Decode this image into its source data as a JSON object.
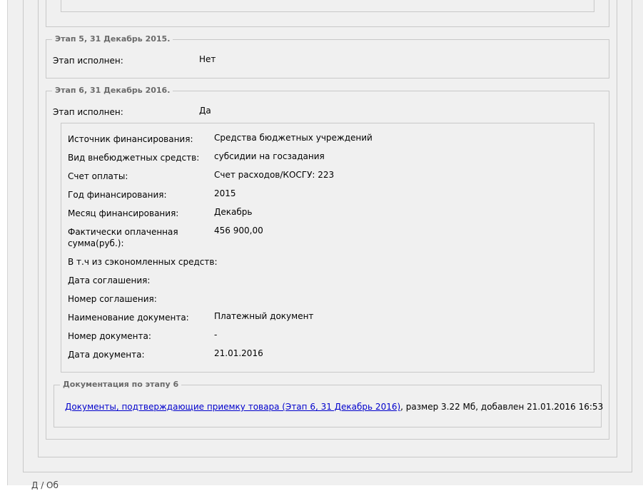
{
  "stage5": {
    "legend": "Этап 5, 31 Декабрь 2015.",
    "completed_label": "Этап исполнен:",
    "completed_value": "Нет"
  },
  "stage6": {
    "legend": "Этап 6, 31 Декабрь 2016.",
    "completed_label": "Этап исполнен:",
    "completed_value": "Да",
    "details": [
      {
        "label": "Источник финансирования:",
        "value": "Средства бюджетных учреждений"
      },
      {
        "label": "Вид внебюджетных средств:",
        "value": "субсидии на госзадания"
      },
      {
        "label": "Счет оплаты:",
        "value": "Счет расходов/КОСГУ: 223"
      },
      {
        "label": "Год финансирования:",
        "value": "2015"
      },
      {
        "label": "Месяц финансирования:",
        "value": "Декабрь"
      },
      {
        "label": "Фактически оплаченная сумма(руб.):",
        "value": "456 900,00"
      },
      {
        "label": "В т.ч из сэкономленных средств:",
        "value": ""
      },
      {
        "label": "Дата соглашения:",
        "value": ""
      },
      {
        "label": "Номер соглашения:",
        "value": ""
      },
      {
        "label": "Наименование документа:",
        "value": "Платежный документ"
      },
      {
        "label": "Номер документа:",
        "value": "-"
      },
      {
        "label": "Дата документа:",
        "value": "21.01.2016"
      }
    ],
    "docs": {
      "legend": "Документация по этапу 6",
      "link_text": "Документы, подтверждающие приемку товара (Этап 6, 31 Декабрь 2016)",
      "info": ", размер 3.22 Мб, добавлен 21.01.2016 16:53"
    }
  },
  "footer": {
    "cut_text": "Д                 / Об"
  }
}
